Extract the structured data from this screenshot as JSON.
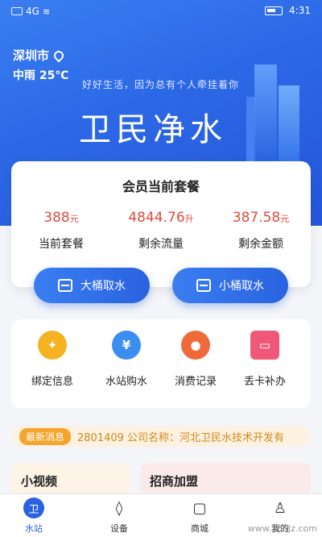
{
  "status_bar": {
    "network": "4G",
    "time": "4:31"
  },
  "location": {
    "city": "深圳市",
    "weather": "中雨 25℃"
  },
  "hero": {
    "slogan": "好好生活，因为总有个人牵挂着你",
    "brand": "卫民净水"
  },
  "membership": {
    "title": "会员当前套餐",
    "stats": [
      {
        "value": "388",
        "unit": "元",
        "label": "当前套餐"
      },
      {
        "value": "4844.76",
        "unit": "升",
        "label": "剩余流量"
      },
      {
        "value": "387.58",
        "unit": "元",
        "label": "剩余金额"
      }
    ]
  },
  "actions": {
    "big_bucket": "大桶取水",
    "small_bucket": "小桶取水"
  },
  "menu": [
    {
      "label": "绑定信息",
      "icon": "bind-icon",
      "color": "#f5b321"
    },
    {
      "label": "水站购水",
      "icon": "money-bag-icon",
      "color": "#3a8ef0"
    },
    {
      "label": "消费记录",
      "icon": "water-drop-icon",
      "color": "#ef6a3a"
    },
    {
      "label": "丢卡补办",
      "icon": "card-icon",
      "color": "#f0587a"
    }
  ],
  "news": {
    "tag": "最新消息",
    "text": "2801409 公司名称：河北卫民水技术开发有"
  },
  "panels": {
    "video": "小视频",
    "franchise": "招商加盟"
  },
  "tabs": [
    {
      "label": "水站",
      "icon": "water-station-icon",
      "glyph": "卫"
    },
    {
      "label": "设备",
      "icon": "drop-outline-icon",
      "glyph": "◊"
    },
    {
      "label": "商城",
      "icon": "bag-icon",
      "glyph": "▢"
    },
    {
      "label": "我的",
      "icon": "user-icon",
      "glyph": "♙"
    }
  ],
  "watermark": "www.365jz.com"
}
